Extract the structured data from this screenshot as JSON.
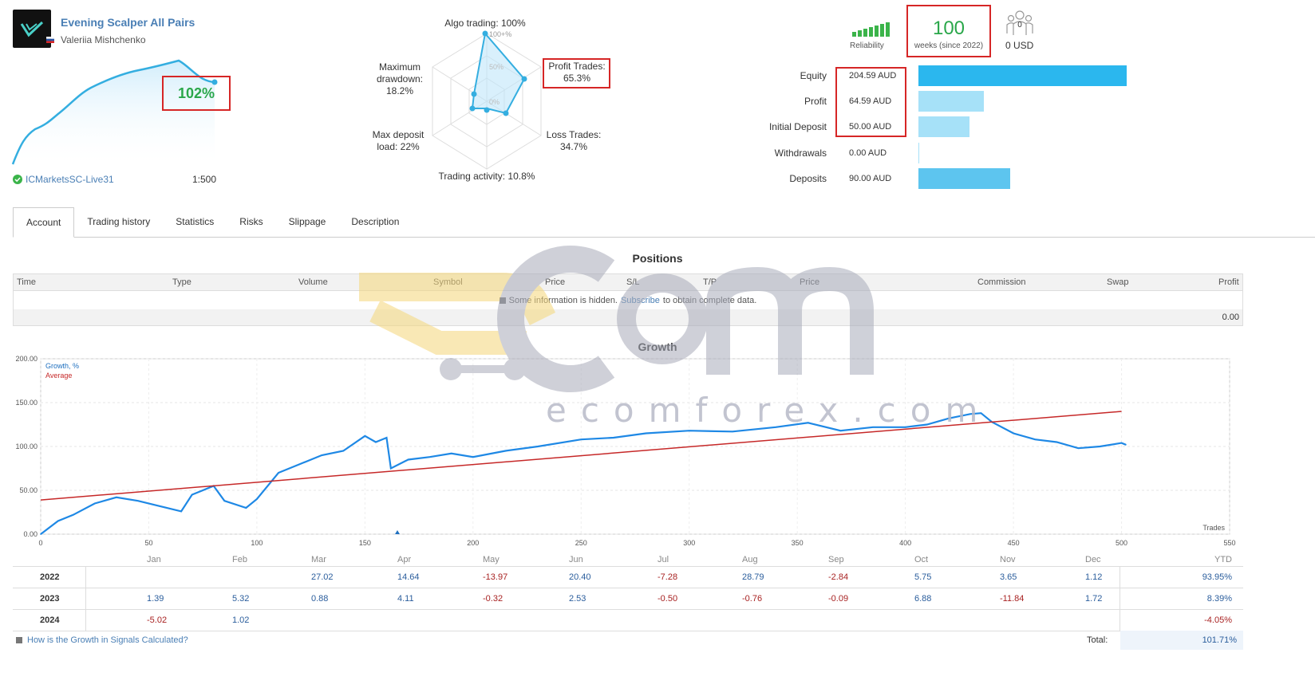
{
  "signal": {
    "title": "Evening Scalper All Pairs",
    "author": "Valeriia Mishchenko",
    "growth": "102%",
    "server": "ICMarketsSC-Live31",
    "leverage": "1:500"
  },
  "radar": {
    "algo": "Algo trading: 100%",
    "profit_trades_label": "Profit Trades:",
    "profit_trades_value": "65.3%",
    "loss_trades_label": "Loss Trades:",
    "loss_trades_value": "34.7%",
    "activity": "Trading activity: 10.8%",
    "max_deposit_label": "Max deposit",
    "max_deposit_value": "load: 22%",
    "max_dd_label1": "Maximum",
    "max_dd_label2": "drawdown:",
    "max_dd_value": "18.2%",
    "ring_100": "100+%",
    "ring_50": "50%",
    "ring_0": "0%"
  },
  "reliability": {
    "label": "Reliability",
    "weeks": "100",
    "weeks_label": "weeks (since 2022)",
    "subscribers": "0",
    "subscribers_usd": "0 USD"
  },
  "balances": [
    {
      "label": "Equity",
      "value": "204.59 AUD",
      "fraction": 1.0,
      "color": "#2bb7ee"
    },
    {
      "label": "Profit",
      "value": "64.59 AUD",
      "fraction": 0.316,
      "color": "#a6e1f8"
    },
    {
      "label": "Initial Deposit",
      "value": "50.00 AUD",
      "fraction": 0.245,
      "color": "#a6e1f8"
    },
    {
      "label": "Withdrawals",
      "value": "0.00 AUD",
      "fraction": 0.0,
      "color": "#a6e1f8"
    },
    {
      "label": "Deposits",
      "value": "90.00 AUD",
      "fraction": 0.44,
      "color": "#5dc5ef"
    }
  ],
  "tabs": [
    "Account",
    "Trading history",
    "Statistics",
    "Risks",
    "Slippage",
    "Description"
  ],
  "positions": {
    "title": "Positions",
    "columns": [
      "Time",
      "Type",
      "Volume",
      "Symbol",
      "Price",
      "S/L",
      "T/P",
      "Price",
      "Commission",
      "Swap",
      "Profit"
    ],
    "info_before": "Some information is hidden.",
    "info_link": "Subscribe",
    "info_after": "to obtain complete data.",
    "total": "0.00"
  },
  "growth_chart": {
    "title": "Growth",
    "legend_growth": "Growth, %",
    "legend_average": "Average",
    "x_unit": "Trades",
    "y_ticks": [
      "0.00",
      "50.00",
      "100.00",
      "150.00",
      "200.00"
    ],
    "x_ticks": [
      "0",
      "50",
      "100",
      "150",
      "200",
      "250",
      "300",
      "350",
      "400",
      "450",
      "500",
      "550"
    ]
  },
  "chart_data": {
    "type": "line",
    "title": "Growth",
    "xlabel": "Trades",
    "ylabel": "",
    "xlim": [
      0,
      550
    ],
    "ylim": [
      0,
      200
    ],
    "grid": true,
    "series": [
      {
        "name": "Growth, %",
        "color": "#1e88e5",
        "x": [
          0,
          8,
          15,
          25,
          35,
          45,
          55,
          65,
          70,
          80,
          85,
          95,
          100,
          110,
          120,
          130,
          140,
          150,
          155,
          160,
          162,
          170,
          180,
          190,
          200,
          215,
          230,
          250,
          265,
          280,
          300,
          320,
          340,
          355,
          370,
          385,
          400,
          410,
          420,
          430,
          435,
          440,
          450,
          460,
          470,
          480,
          490,
          500,
          502
        ],
        "y": [
          0,
          15,
          22,
          35,
          42,
          38,
          32,
          26,
          45,
          55,
          38,
          30,
          40,
          70,
          80,
          90,
          95,
          112,
          105,
          110,
          75,
          85,
          88,
          92,
          88,
          95,
          100,
          108,
          110,
          115,
          118,
          117,
          122,
          127,
          118,
          122,
          122,
          125,
          132,
          137,
          138,
          128,
          115,
          108,
          105,
          98,
          100,
          104,
          102
        ]
      },
      {
        "name": "Average",
        "color": "#c62828",
        "x": [
          0,
          500
        ],
        "y": [
          39,
          140
        ]
      }
    ]
  },
  "monthly": {
    "months": [
      "Jan",
      "Feb",
      "Mar",
      "Apr",
      "May",
      "Jun",
      "Jul",
      "Aug",
      "Sep",
      "Oct",
      "Nov",
      "Dec"
    ],
    "ytd_label": "YTD",
    "rows": [
      {
        "year": "2022",
        "values": [
          "",
          "",
          "27.02",
          "14.64",
          "-13.97",
          "20.40",
          "-7.28",
          "28.79",
          "-2.84",
          "5.75",
          "3.65",
          "1.12"
        ],
        "ytd": "93.95%"
      },
      {
        "year": "2023",
        "values": [
          "1.39",
          "5.32",
          "0.88",
          "4.11",
          "-0.32",
          "2.53",
          "-0.50",
          "-0.76",
          "-0.09",
          "6.88",
          "-11.84",
          "1.72"
        ],
        "ytd": "8.39%"
      },
      {
        "year": "2024",
        "values": [
          "-5.02",
          "1.02",
          "",
          "",
          "",
          "",
          "",
          "",
          "",
          "",
          "",
          ""
        ],
        "ytd": "-4.05%"
      }
    ],
    "footer_link": "How is the Growth in Signals Calculated?",
    "total_label": "Total:",
    "total_value": "101.71%"
  },
  "watermark": "ecomforex.com"
}
